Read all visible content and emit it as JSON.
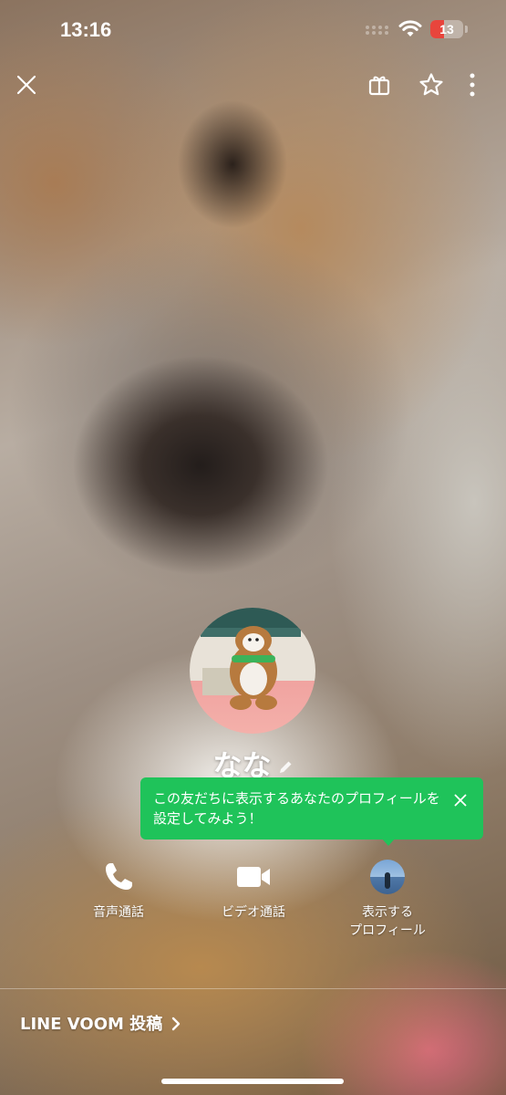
{
  "status_bar": {
    "time": "13:16",
    "battery": "13",
    "battery_level": 0.13
  },
  "top_bar": {
    "icons": [
      "close-icon",
      "gift-icon",
      "star-icon",
      "more-icon"
    ]
  },
  "profile": {
    "name": "なな"
  },
  "tooltip": {
    "text": "この友だちに表示するあなたのプロフィールを設定してみよう！"
  },
  "actions": [
    {
      "icon": "phone-icon",
      "label": "音声通話"
    },
    {
      "icon": "video-icon",
      "label": "ビデオ通話"
    },
    {
      "icon": "profile-avatar-icon",
      "label": "表示する\nプロフィール"
    }
  ],
  "footer": {
    "voom_label": "LINE VOOM 投稿"
  },
  "colors": {
    "accent_green": "#1fc35a",
    "battery_red": "#e8453c"
  }
}
